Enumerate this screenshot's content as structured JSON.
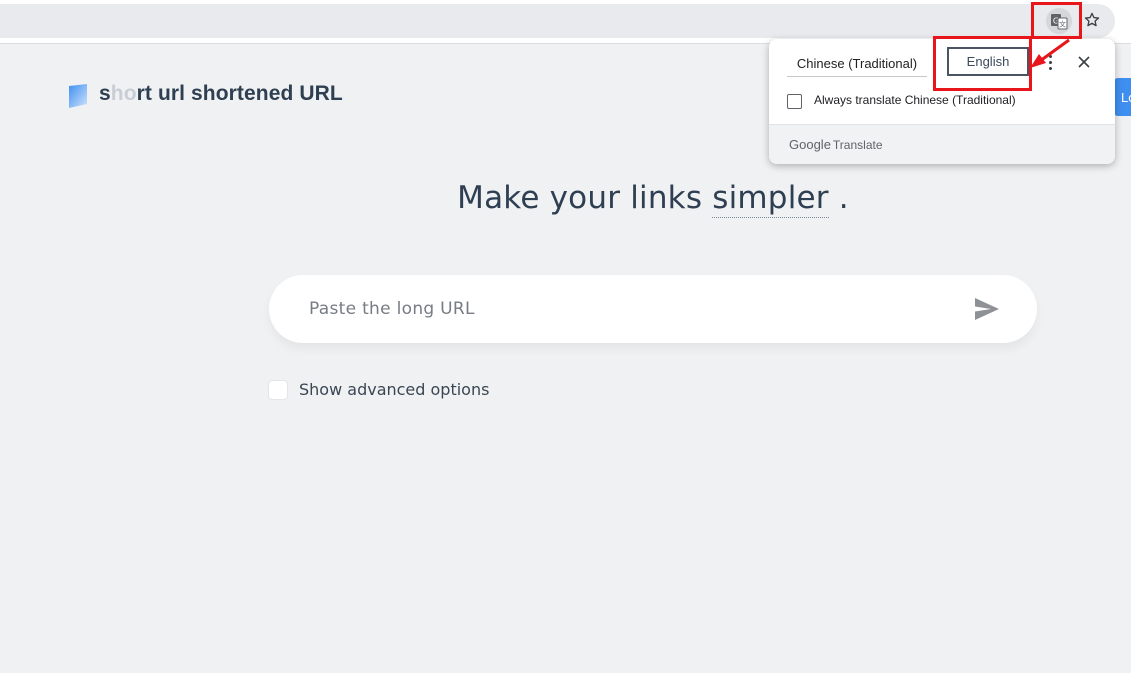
{
  "browser": {
    "translate_icon": "translate-icon",
    "bookmark_icon": "star-outline-icon"
  },
  "brand": {
    "part1": "s",
    "part2": "ho",
    "part3": "rt url shortened URL"
  },
  "right_button_peek": "Lo",
  "headline": {
    "prefix": "Make your links",
    "word": "simpler",
    "suffix": "."
  },
  "url_input": {
    "placeholder": "Paste the long URL",
    "value": ""
  },
  "advanced_options_label": "Show advanced options",
  "translate_popup": {
    "source_tab": "Chinese (Traditional)",
    "target_tab": "English",
    "always_translate_label": "Always translate Chinese (Traditional)",
    "footer_google": "Google",
    "footer_translate": "Translate"
  },
  "colors": {
    "annotation_red": "#e8151b",
    "brand_dark": "#2f3f52",
    "accent_blue": "#3f8ff0"
  }
}
